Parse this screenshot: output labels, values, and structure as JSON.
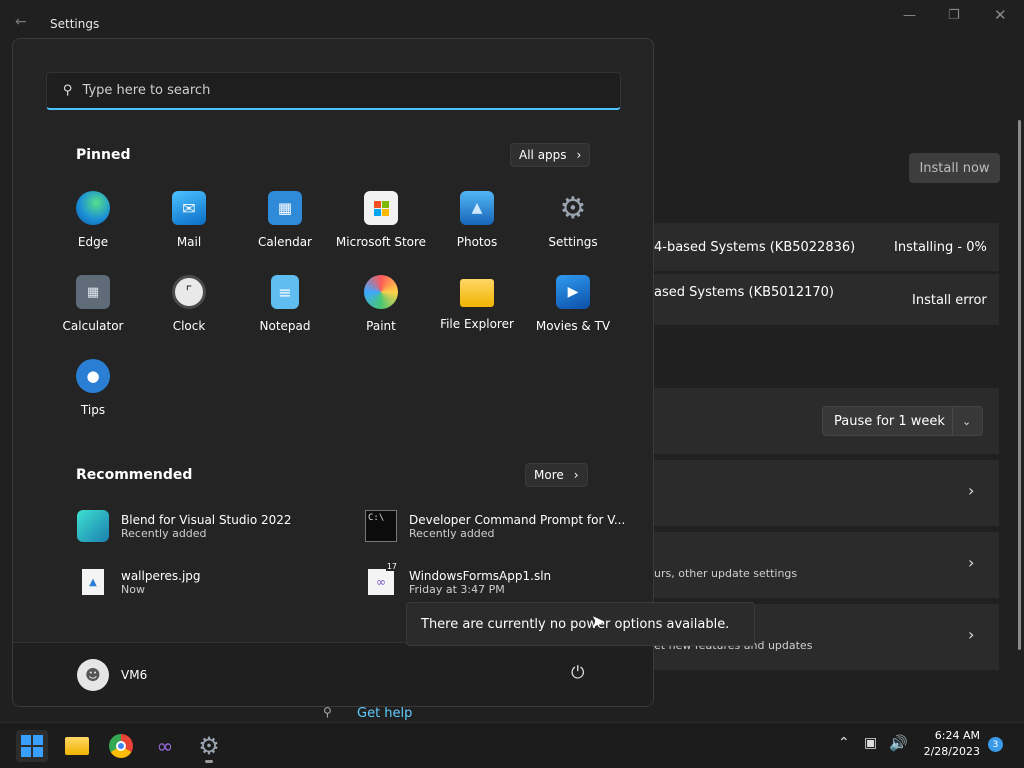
{
  "settings_window": {
    "title": "Settings",
    "install_now": "Install now",
    "updates": [
      {
        "name": "4-based Systems (KB5022836)",
        "status": "Installing - 0%"
      },
      {
        "name": "ased Systems (KB5012170)",
        "status": "Install error"
      }
    ],
    "pause_label": "Pause for 1 week",
    "advanced_sub": "urs, other update settings",
    "insider_sub": "et new features and updates",
    "get_help": "Get help"
  },
  "start_menu": {
    "search_placeholder": "Type here to search",
    "pinned_title": "Pinned",
    "all_apps_label": "All apps",
    "pinned": [
      {
        "label": "Edge",
        "icon": "edge-icon"
      },
      {
        "label": "Mail",
        "icon": "mail-icon"
      },
      {
        "label": "Calendar",
        "icon": "calendar-icon"
      },
      {
        "label": "Microsoft Store",
        "icon": "store-icon"
      },
      {
        "label": "Photos",
        "icon": "photos-icon"
      },
      {
        "label": "Settings",
        "icon": "gear-icon"
      },
      {
        "label": "Calculator",
        "icon": "calculator-icon"
      },
      {
        "label": "Clock",
        "icon": "clock-icon"
      },
      {
        "label": "Notepad",
        "icon": "notepad-icon"
      },
      {
        "label": "Paint",
        "icon": "paint-icon"
      },
      {
        "label": "File Explorer",
        "icon": "folder-icon"
      },
      {
        "label": "Movies & TV",
        "icon": "movies-icon"
      },
      {
        "label": "Tips",
        "icon": "lightbulb-icon"
      }
    ],
    "recommended_title": "Recommended",
    "more_label": "More",
    "recommended": [
      {
        "title": "Blend for Visual Studio 2022",
        "sub": "Recently added",
        "icon": "blend-icon"
      },
      {
        "title": "Developer Command Prompt for V...",
        "sub": "Recently added",
        "icon": "terminal-icon"
      },
      {
        "title": "wallperes.jpg",
        "sub": "Now",
        "icon": "image-file-icon"
      },
      {
        "title": "WindowsFormsApp1.sln",
        "sub": "Friday at 3:47 PM",
        "icon": "vs-solution-icon",
        "badge": "17"
      }
    ],
    "user_name": "VM6",
    "tooltip": "There are currently no power options available."
  },
  "taskbar": {
    "time": "6:24 AM",
    "date": "2/28/2023",
    "notification_count": "3"
  }
}
